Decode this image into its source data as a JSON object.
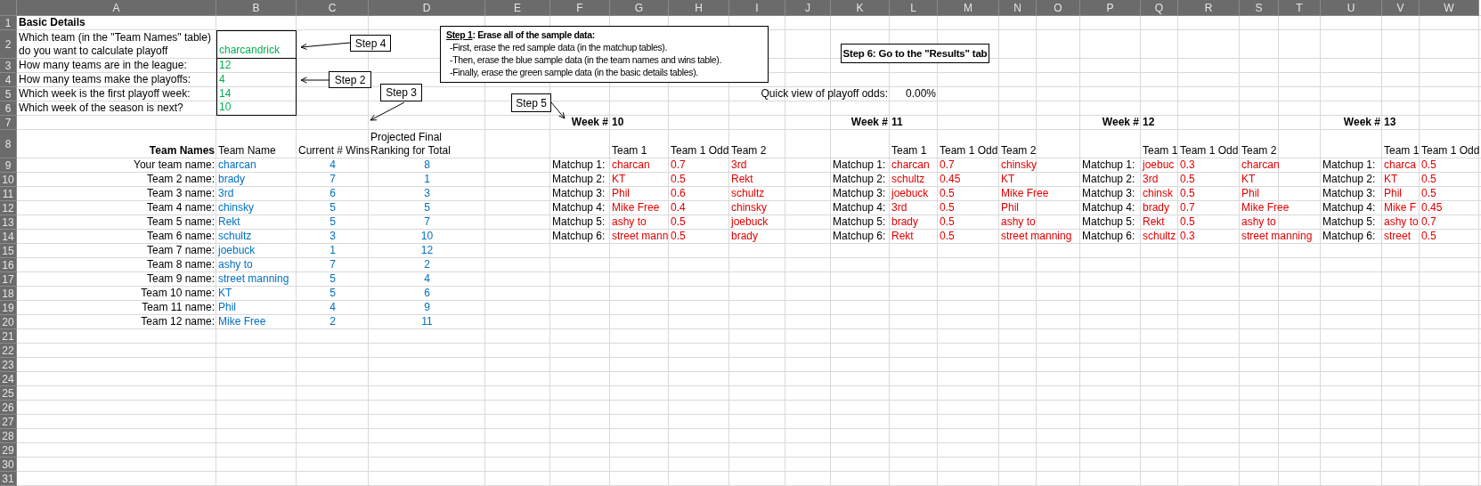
{
  "column_headers": [
    "A",
    "B",
    "C",
    "D",
    "E",
    "F",
    "G",
    "H",
    "I",
    "J",
    "K",
    "L",
    "M",
    "N",
    "O",
    "P",
    "Q",
    "R",
    "S",
    "T",
    "U",
    "V",
    "W"
  ],
  "row_numbers": [
    "1",
    "2",
    "3",
    "4",
    "5",
    "6",
    "7",
    "8",
    "9",
    "10",
    "11",
    "12",
    "13",
    "14",
    "15",
    "16",
    "17",
    "18",
    "19",
    "20",
    "21",
    "22",
    "23",
    "24",
    "25",
    "26",
    "27",
    "28",
    "29",
    "30",
    "31"
  ],
  "basic_details": {
    "title": "Basic Details",
    "questions": [
      {
        "label": "Which team (in the \"Team Names\" table) do you want to calculate playoff",
        "answer": "charcandrick"
      },
      {
        "label": "How many teams are in the league:",
        "answer": "12"
      },
      {
        "label": "How many teams make the playoffs:",
        "answer": "4"
      },
      {
        "label": "Which week is the first playoff week:",
        "answer": "14"
      },
      {
        "label": "Which week of the season is next?",
        "answer": "10"
      }
    ]
  },
  "team_table": {
    "title": "Team Names",
    "columns": [
      "Team Name",
      "Current # Wins",
      "Projected Final Ranking for Total"
    ],
    "rows": [
      {
        "label": "Your team name:",
        "name": "charcan",
        "wins": "4",
        "ranking": "8"
      },
      {
        "label": "Team 2 name:",
        "name": "brady",
        "wins": "7",
        "ranking": "1"
      },
      {
        "label": "Team 3 name:",
        "name": "3rd",
        "wins": "6",
        "ranking": "3"
      },
      {
        "label": "Team 4 name:",
        "name": "chinsky",
        "wins": "5",
        "ranking": "5"
      },
      {
        "label": "Team 5 name:",
        "name": "Rekt",
        "wins": "5",
        "ranking": "7"
      },
      {
        "label": "Team 6 name:",
        "name": "schultz",
        "wins": "3",
        "ranking": "10"
      },
      {
        "label": "Team 7 name:",
        "name": "joebuck",
        "wins": "1",
        "ranking": "12"
      },
      {
        "label": "Team 8 name:",
        "name": "ashy to",
        "wins": "7",
        "ranking": "2"
      },
      {
        "label": "Team 9 name:",
        "name": "street manning",
        "wins": "5",
        "ranking": "4"
      },
      {
        "label": "Team 10 name:",
        "name": "KT",
        "wins": "5",
        "ranking": "6"
      },
      {
        "label": "Team 11 name:",
        "name": "Phil",
        "wins": "4",
        "ranking": "9"
      },
      {
        "label": "Team 12 name:",
        "name": "Mike Free",
        "wins": "2",
        "ranking": "11"
      }
    ]
  },
  "quick_view": {
    "label": "Quick view of playoff odds:",
    "value": "0.00%"
  },
  "weeks": [
    {
      "label": "Week #",
      "number": "10",
      "headers": [
        "Team 1",
        "Team 1 Odd",
        "Team 2"
      ],
      "matchups": [
        {
          "label": "Matchup 1:",
          "team1": "charcan",
          "odds": "0.7",
          "team2": "3rd"
        },
        {
          "label": "Matchup 2:",
          "team1": "KT",
          "odds": "0.5",
          "team2": "Rekt"
        },
        {
          "label": "Matchup 3:",
          "team1": "Phil",
          "odds": "0.6",
          "team2": "schultz"
        },
        {
          "label": "Matchup 4:",
          "team1": "Mike Free",
          "odds": "0.4",
          "team2": "chinsky"
        },
        {
          "label": "Matchup 5:",
          "team1": "ashy to",
          "odds": "0.5",
          "team2": "joebuck"
        },
        {
          "label": "Matchup 6:",
          "team1": "street mann",
          "odds": "0.5",
          "team2": "brady"
        }
      ]
    },
    {
      "label": "Week #",
      "number": "11",
      "headers": [
        "Team 1",
        "Team 1 Odd",
        "Team 2"
      ],
      "matchups": [
        {
          "label": "Matchup 1:",
          "team1": "charcan",
          "odds": "0.7",
          "team2": "chinsky"
        },
        {
          "label": "Matchup 2:",
          "team1": "schultz",
          "odds": "0.45",
          "team2": "KT"
        },
        {
          "label": "Matchup 3:",
          "team1": "joebuck",
          "odds": "0.5",
          "team2": "Mike Free"
        },
        {
          "label": "Matchup 4:",
          "team1": "3rd",
          "odds": "0.5",
          "team2": "Phil"
        },
        {
          "label": "Matchup 5:",
          "team1": "brady",
          "odds": "0.5",
          "team2": "ashy to"
        },
        {
          "label": "Matchup 6:",
          "team1": "Rekt",
          "odds": "0.5",
          "team2": "street manning"
        }
      ]
    },
    {
      "label": "Week #",
      "number": "12",
      "headers": [
        "Team 1",
        "Team 1 Odd",
        "Team 2"
      ],
      "matchups": [
        {
          "label": "Matchup 1:",
          "team1": "joebuc",
          "odds": "0.3",
          "team2": "charcan"
        },
        {
          "label": "Matchup 2:",
          "team1": "3rd",
          "odds": "0.5",
          "team2": "KT"
        },
        {
          "label": "Matchup 3:",
          "team1": "chinsk",
          "odds": "0.5",
          "team2": "Phil"
        },
        {
          "label": "Matchup 4:",
          "team1": "brady",
          "odds": "0.7",
          "team2": "Mike Free"
        },
        {
          "label": "Matchup 5:",
          "team1": "Rekt",
          "odds": "0.5",
          "team2": "ashy to"
        },
        {
          "label": "Matchup 6:",
          "team1": "schultz",
          "odds": "0.3",
          "team2": "street manning"
        }
      ]
    },
    {
      "label": "Week #",
      "number": "13",
      "headers": [
        "Team 1",
        "Team 1 Odd"
      ],
      "matchups": [
        {
          "label": "Matchup 1:",
          "team1": "charca",
          "odds": "0.5"
        },
        {
          "label": "Matchup 2:",
          "team1": "KT",
          "odds": "0.5"
        },
        {
          "label": "Matchup 3:",
          "team1": "Phil",
          "odds": "0.5"
        },
        {
          "label": "Matchup 4:",
          "team1": "Mike F",
          "odds": "0.45"
        },
        {
          "label": "Matchup 5:",
          "team1": "ashy to",
          "odds": "0.7"
        },
        {
          "label": "Matchup 6:",
          "team1": "street",
          "odds": "0.5"
        }
      ]
    }
  ],
  "instructions": {
    "step": "Step 1",
    "title": ": Erase all of the sample data:",
    "lines": [
      "-First, erase the red sample data (in the matchup tables).",
      "-Then, erase the blue sample data (in the team names and wins table).",
      "-Finally, erase the green sample data (in the basic details tables)."
    ]
  },
  "callouts": [
    {
      "kind": "pointer",
      "text": "Step 4"
    },
    {
      "kind": "pointer",
      "text": "Step 2"
    },
    {
      "kind": "pointer",
      "text": "Step 3"
    },
    {
      "kind": "pointer",
      "text": "Step 5"
    },
    {
      "kind": "banner",
      "text": "Step 6: Go to the \"Results\" tab"
    }
  ]
}
